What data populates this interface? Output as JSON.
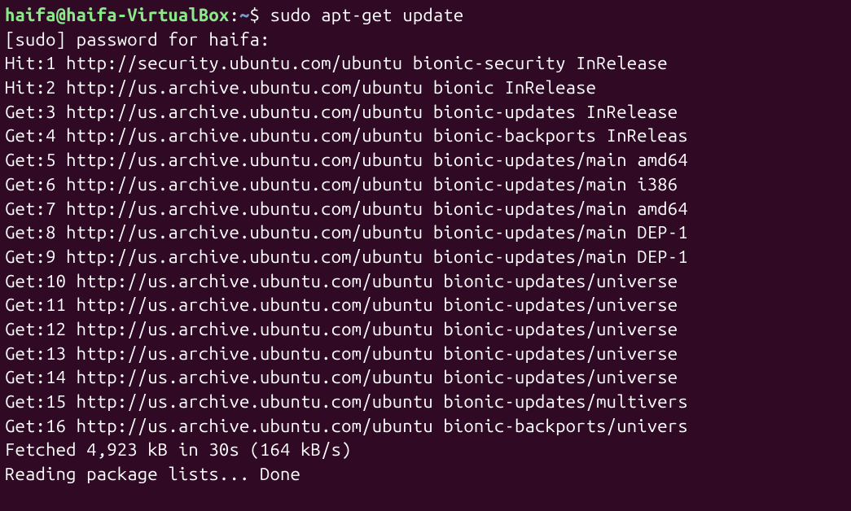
{
  "prompt": {
    "user_host": "haifa@haifa-VirtualBox",
    "separator": ":",
    "path": "~",
    "symbol": "$ ",
    "command": "sudo apt-get update"
  },
  "lines": [
    "[sudo] password for haifa:",
    "Hit:1 http://security.ubuntu.com/ubuntu bionic-security InRelease",
    "Hit:2 http://us.archive.ubuntu.com/ubuntu bionic InRelease",
    "Get:3 http://us.archive.ubuntu.com/ubuntu bionic-updates InRelease",
    "Get:4 http://us.archive.ubuntu.com/ubuntu bionic-backports InReleas",
    "Get:5 http://us.archive.ubuntu.com/ubuntu bionic-updates/main amd64",
    "Get:6 http://us.archive.ubuntu.com/ubuntu bionic-updates/main i386",
    "Get:7 http://us.archive.ubuntu.com/ubuntu bionic-updates/main amd64",
    "Get:8 http://us.archive.ubuntu.com/ubuntu bionic-updates/main DEP-1",
    "Get:9 http://us.archive.ubuntu.com/ubuntu bionic-updates/main DEP-1",
    "Get:10 http://us.archive.ubuntu.com/ubuntu bionic-updates/universe",
    "Get:11 http://us.archive.ubuntu.com/ubuntu bionic-updates/universe",
    "Get:12 http://us.archive.ubuntu.com/ubuntu bionic-updates/universe",
    "Get:13 http://us.archive.ubuntu.com/ubuntu bionic-updates/universe",
    "Get:14 http://us.archive.ubuntu.com/ubuntu bionic-updates/universe",
    "Get:15 http://us.archive.ubuntu.com/ubuntu bionic-updates/multivers",
    "Get:16 http://us.archive.ubuntu.com/ubuntu bionic-backports/univers",
    "Fetched 4,923 kB in 30s (164 kB/s)",
    "Reading package lists... Done"
  ]
}
